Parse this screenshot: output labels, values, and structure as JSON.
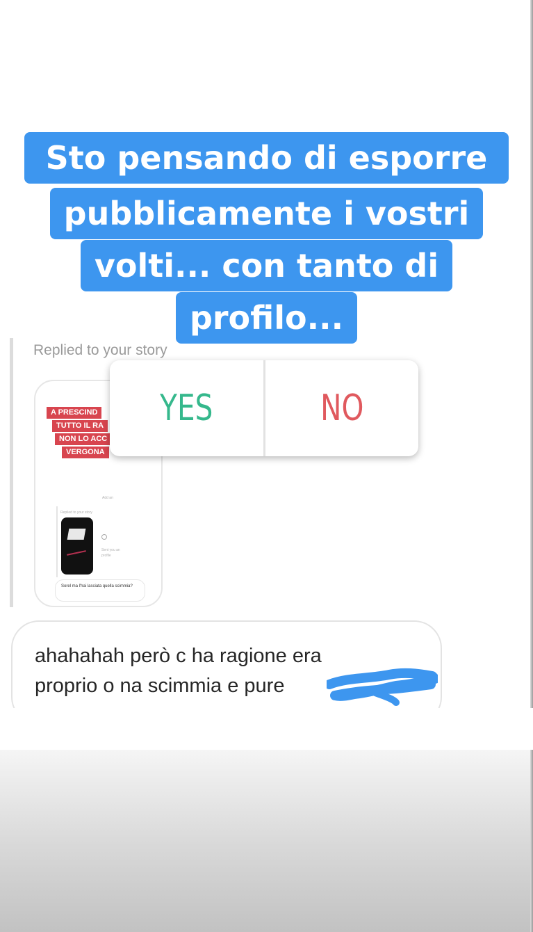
{
  "story": {
    "caption_lines": [
      "Sto pensando di esporre",
      "pubblicamente i vostri",
      "volti... con tanto di",
      "profilo..."
    ],
    "caption_color": "#3d96ef",
    "reply_label": "Replied to your story",
    "thumbnail": {
      "caption_lines": [
        "A PRESCIND",
        "TUTTO IL RA",
        "NON LO ACC",
        "VERGONA"
      ],
      "small_text_1": "Add an",
      "small_text_2": "Replied to your story",
      "small_text_3": "Sent you an",
      "small_text_4": "profile",
      "bubble_text": "Sorel ma l'hai lasciata quella scimmia?"
    },
    "poll": {
      "yes_label": "YES",
      "no_label": "NO",
      "yes_color": "#35b88c",
      "no_color": "#e0595e"
    },
    "message": {
      "line1": "ahahahah però c ha ragione era",
      "line2": "proprio o na scimmia e pure"
    }
  }
}
